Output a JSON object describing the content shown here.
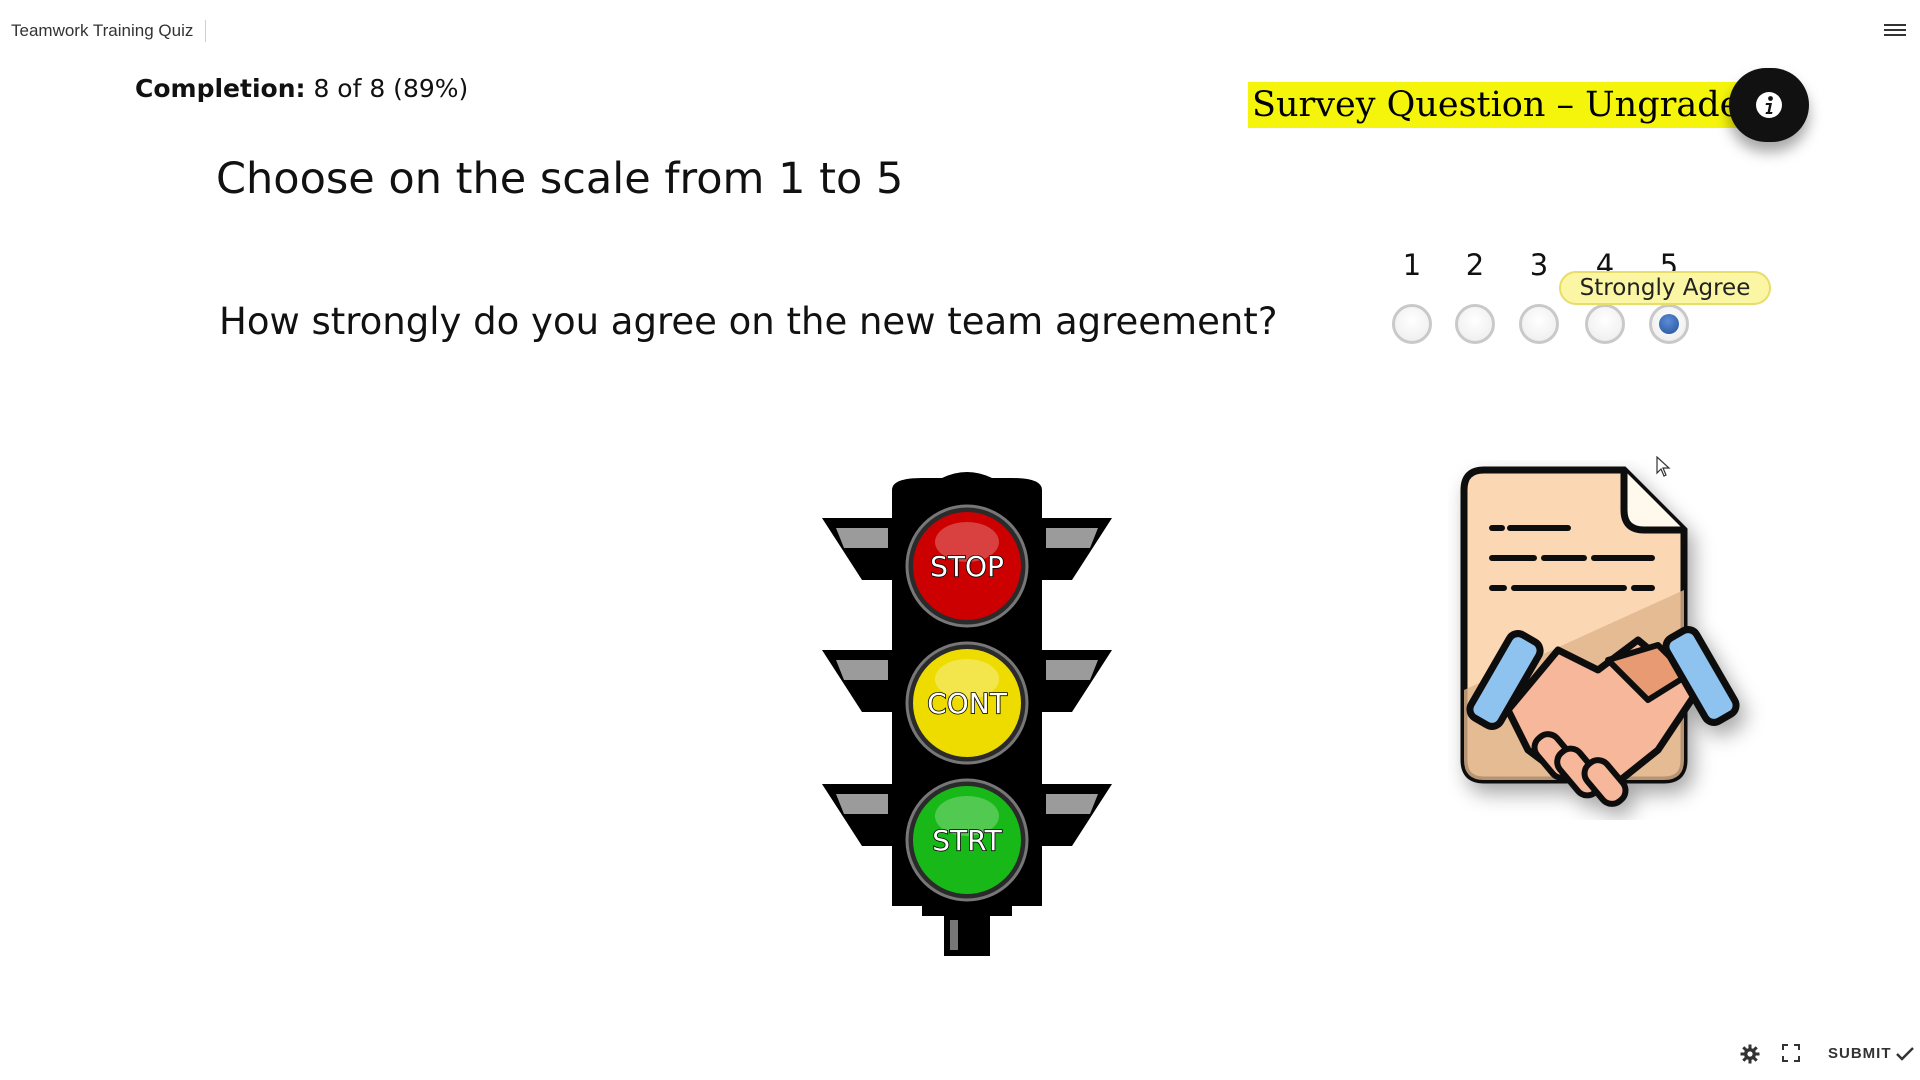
{
  "header": {
    "app_title": "Teamwork Training Quiz",
    "menu_icon": "hamburger-menu-icon"
  },
  "completion": {
    "label": "Completion:",
    "value": "8 of 8 (89%)"
  },
  "survey_tag": {
    "text": "Survey Question – Ungraded",
    "background": "#f5f50c"
  },
  "info_icon": "info-icon",
  "question": {
    "heading": "Choose on the scale from 1 to 5",
    "text": "How strongly do you agree on the new team agreement?"
  },
  "scale": {
    "options": [
      "1",
      "2",
      "3",
      "4",
      "5"
    ],
    "selected": "5",
    "tooltip": "Strongly Agree",
    "selected_color": "#2f5ea8"
  },
  "traffic_light": {
    "labels": [
      "STOP",
      "CONT",
      "STRT"
    ],
    "colors": [
      "#d10000",
      "#f2e500",
      "#1fc41f"
    ]
  },
  "illustration": "contract-handshake-icon",
  "footer": {
    "settings_icon": "gear-icon",
    "fullscreen_icon": "fullscreen-icon",
    "submit_label": "SUBMIT",
    "submit_icon": "checkmark-icon"
  }
}
